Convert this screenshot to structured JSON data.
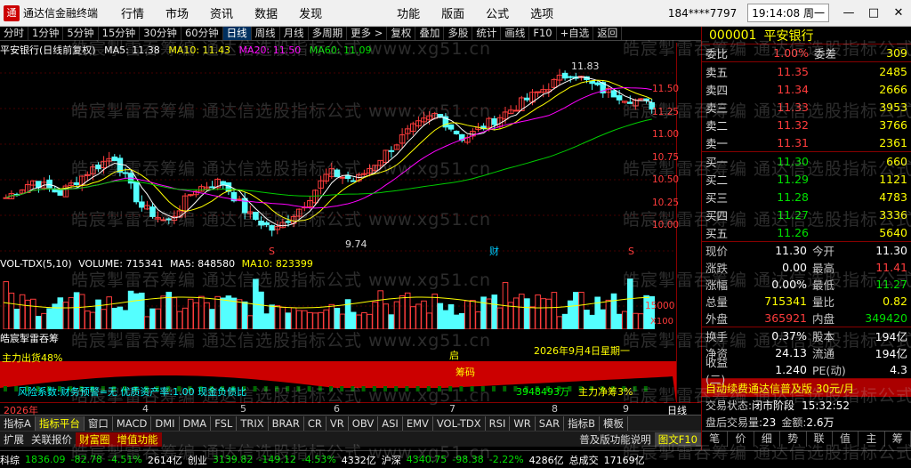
{
  "titlebar": {
    "app": "通达信金融终端",
    "menus": [
      "行情",
      "市场",
      "资讯",
      "数据",
      "发现",
      "功能",
      "版面",
      "公式",
      "选项"
    ],
    "account": "184****7797",
    "time": "19:14:08 周一"
  },
  "toolbar": [
    "分时",
    "1分钟",
    "5分钟",
    "15分钟",
    "30分钟",
    "60分钟",
    "日线",
    "周线",
    "月线",
    "多周期",
    "更多 >",
    "复权",
    "叠加",
    "多股",
    "统计",
    "画线",
    "F10",
    "+自选",
    "返回"
  ],
  "chart": {
    "title": "平安银行(日线前复权)",
    "ma5": "MA5: 11.38",
    "ma10": "MA10: 11.43",
    "ma20": "MA20: 11.50",
    "ma60": "MA60: 11.09",
    "high_label": "11.83",
    "low_label": "9.74",
    "event_s1": "S",
    "event_cai": "财",
    "event_s2": "S",
    "yticks": [
      "11.50",
      "11.25",
      "11.00",
      "10.75",
      "10.50",
      "10.25",
      "10.00"
    ]
  },
  "volume": {
    "header_name": "VOL-TDX(5,10)",
    "volume": "VOLUME: 715341",
    "ma5": "MA5: 848580",
    "ma10": "MA10: 823399",
    "ytick": "15000",
    "unit": "X100"
  },
  "indicator": {
    "name": "皓宸掣雷吞筹",
    "left_label": "主力出货48%",
    "start_label": "启",
    "jiechu_label": "筹码",
    "date_label": "2026年9月4日星期一",
    "risk_text": "风险系数:财务预警=无 优质资产率:1.00 现金负债比",
    "ratio1": "3948493万",
    "ratio2": "主力净筹3%"
  },
  "date_axis": {
    "year": "2026年",
    "months": [
      "4",
      "5",
      "6",
      "7",
      "8",
      "9"
    ],
    "period": "日线"
  },
  "tabs1": [
    "指标A",
    "指标平台",
    "窗口",
    "MACD",
    "DMI",
    "DMA",
    "FSL",
    "TRIX",
    "BRAR",
    "CR",
    "VR",
    "OBV",
    "ASI",
    "EMV",
    "VOL-TDX",
    "RSI",
    "WR",
    "SAR",
    "指标B",
    "模板"
  ],
  "tabs2": [
    "扩展",
    "关联报价",
    "财富圈",
    "增值功能"
  ],
  "tabs2_right": [
    "普及版功能说明",
    "图文F10"
  ],
  "statusbar": [
    {
      "name": "科综",
      "val": "1836.09",
      "chg": "-82.78",
      "pct": "-4.51%",
      "amt": "2614亿"
    },
    {
      "name": "创业",
      "val": "3139.82",
      "chg": "-149.12",
      "pct": "-4.53%",
      "amt": "4332亿"
    },
    {
      "name": "沪深",
      "val": "4340.75",
      "chg": "-98.38",
      "pct": "-2.22%",
      "amt": "4286亿"
    }
  ],
  "status_total_label": "总成交",
  "status_total": "17169亿",
  "right": {
    "code": "000001",
    "name": "平安银行",
    "wei_bi_label": "委比",
    "wei_bi": "1.00%",
    "wei_cha_label": "委差",
    "wei_cha": "309",
    "asks": [
      {
        "l": "卖五",
        "p": "11.35",
        "q": "2485"
      },
      {
        "l": "卖四",
        "p": "11.34",
        "q": "2666"
      },
      {
        "l": "卖三",
        "p": "11.33",
        "q": "3953"
      },
      {
        "l": "卖二",
        "p": "11.32",
        "q": "3766"
      },
      {
        "l": "卖一",
        "p": "11.31",
        "q": "2361"
      }
    ],
    "bids": [
      {
        "l": "买一",
        "p": "11.30",
        "q": "660"
      },
      {
        "l": "买二",
        "p": "11.29",
        "q": "1121"
      },
      {
        "l": "买三",
        "p": "11.28",
        "q": "4783"
      },
      {
        "l": "买四",
        "p": "11.27",
        "q": "3336"
      },
      {
        "l": "买五",
        "p": "11.26",
        "q": "5640"
      }
    ],
    "stats": [
      [
        "现价",
        "11.30",
        "今开",
        "11.30"
      ],
      [
        "涨跌",
        "0.00",
        "最高",
        "11.41"
      ],
      [
        "涨幅",
        "0.00%",
        "最低",
        "11.27"
      ],
      [
        "总量",
        "715341",
        "量比",
        "0.82"
      ],
      [
        "外盘",
        "365921",
        "内盘",
        "349420"
      ]
    ],
    "stats2": [
      [
        "换手",
        "0.37%",
        "股本",
        "194亿"
      ],
      [
        "净资",
        "24.13",
        "流通",
        "194亿"
      ],
      [
        "收益(二)",
        "1.240",
        "PE(动)",
        "4.3"
      ]
    ],
    "promo": "自动续费通达信普及版 30元/月",
    "trade_status_label": "交易状态:",
    "trade_status": "闭市阶段",
    "trade_time": "15:32:52",
    "after_label": "盘后交易量:",
    "after_vol": "23",
    "after_amt_label": "金额:",
    "after_amt": "2.6万",
    "bottom_btns": [
      "笔",
      "价",
      "细",
      "势",
      "联",
      "值",
      "主",
      "筹"
    ]
  },
  "watermark": "皓宸掣雷吞筹编 通达信选股指标公式 www.xg51.cn"
}
